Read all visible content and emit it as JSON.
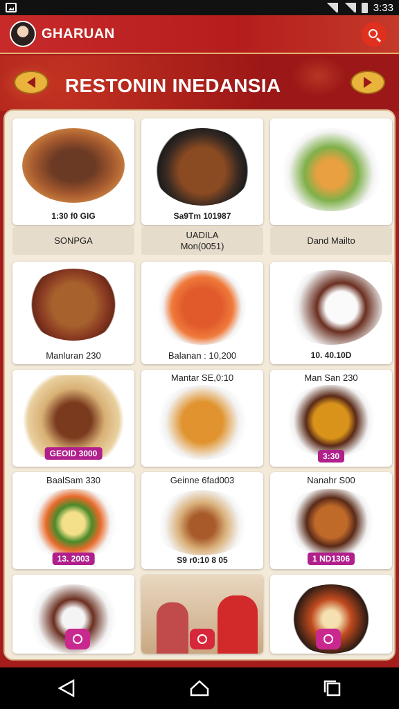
{
  "status": {
    "time": "3:33"
  },
  "header": {
    "app_name": "GHARUAN"
  },
  "banner": {
    "title": "RESTONIN INEDANSIA"
  },
  "menu_items": [
    {
      "price": "1:30 f0 GIG",
      "label": "SONPGA"
    },
    {
      "price": "Sa9Tm 101987",
      "label": "UADILA\nMon(0051)"
    },
    {
      "price": "",
      "label": "Dand Mailto"
    },
    {
      "price": "",
      "label": "Manluran 230"
    },
    {
      "price": "",
      "label": "Balanan : 10,200"
    },
    {
      "price": "10. 40.10D",
      "label": ""
    },
    {
      "price": "",
      "label": "Mantar SE,0:10"
    },
    {
      "price": "",
      "label": "Man San 230"
    },
    {
      "price": "GEOID 3000",
      "label": ""
    },
    {
      "price": "3:30",
      "label": ""
    },
    {
      "price": "",
      "label": "BaalSam 330"
    },
    {
      "price": "",
      "label": "Geinne 6fad003"
    },
    {
      "price": "",
      "label": "Nanahr S00"
    },
    {
      "price": "13. 2003",
      "label": ""
    },
    {
      "price": "S9 r0:10 8 05",
      "label": ""
    },
    {
      "price": "1 ND1306",
      "label": ""
    }
  ],
  "colors": {
    "primary": "#b51d1d",
    "accent": "#e9b33c",
    "badge": "#b01f8c"
  }
}
